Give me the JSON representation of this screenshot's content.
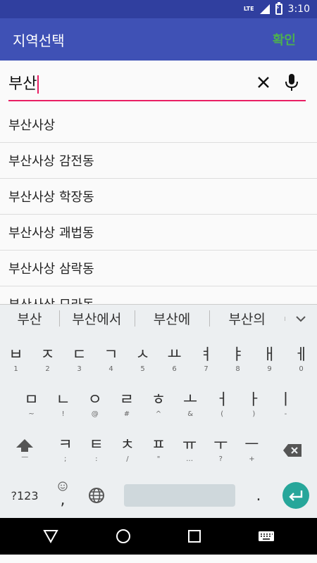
{
  "status": {
    "network": "LTE",
    "time": "3:10"
  },
  "appbar": {
    "title": "지역선택",
    "confirm": "확인"
  },
  "search": {
    "value": "부산"
  },
  "results": [
    "부산사상",
    "부산사상 감전동",
    "부산사상 학장동",
    "부산사상 괘법동",
    "부산사상 삼락동",
    "부산사상 모라동"
  ],
  "suggestions": [
    "부산",
    "부산에서",
    "부산에",
    "부산의"
  ],
  "keyboard": {
    "row1": [
      {
        "m": "ㅂ",
        "s": "1"
      },
      {
        "m": "ㅈ",
        "s": "2"
      },
      {
        "m": "ㄷ",
        "s": "3"
      },
      {
        "m": "ㄱ",
        "s": "4"
      },
      {
        "m": "ㅅ",
        "s": "5"
      },
      {
        "m": "ㅛ",
        "s": "6"
      },
      {
        "m": "ㅕ",
        "s": "7"
      },
      {
        "m": "ㅑ",
        "s": "8"
      },
      {
        "m": "ㅐ",
        "s": "9"
      },
      {
        "m": "ㅔ",
        "s": "0"
      }
    ],
    "row2": [
      {
        "m": "ㅁ",
        "s": "~"
      },
      {
        "m": "ㄴ",
        "s": "!"
      },
      {
        "m": "ㅇ",
        "s": "@"
      },
      {
        "m": "ㄹ",
        "s": "#"
      },
      {
        "m": "ㅎ",
        "s": "^"
      },
      {
        "m": "ㅗ",
        "s": "&"
      },
      {
        "m": "ㅓ",
        "s": "("
      },
      {
        "m": "ㅏ",
        "s": ")"
      },
      {
        "m": "ㅣ",
        "s": "-"
      }
    ],
    "row3": [
      {
        "m": "ㅋ",
        "s": ";"
      },
      {
        "m": "ㅌ",
        "s": ":"
      },
      {
        "m": "ㅊ",
        "s": "/"
      },
      {
        "m": "ㅍ",
        "s": "\""
      },
      {
        "m": "ㅠ",
        "s": "…"
      },
      {
        "m": "ㅜ",
        "s": "?"
      },
      {
        "m": "ㅡ",
        "s": "+"
      }
    ],
    "shift_sub": "—",
    "symbols_label": "?123",
    "comma": ",",
    "period": "."
  }
}
